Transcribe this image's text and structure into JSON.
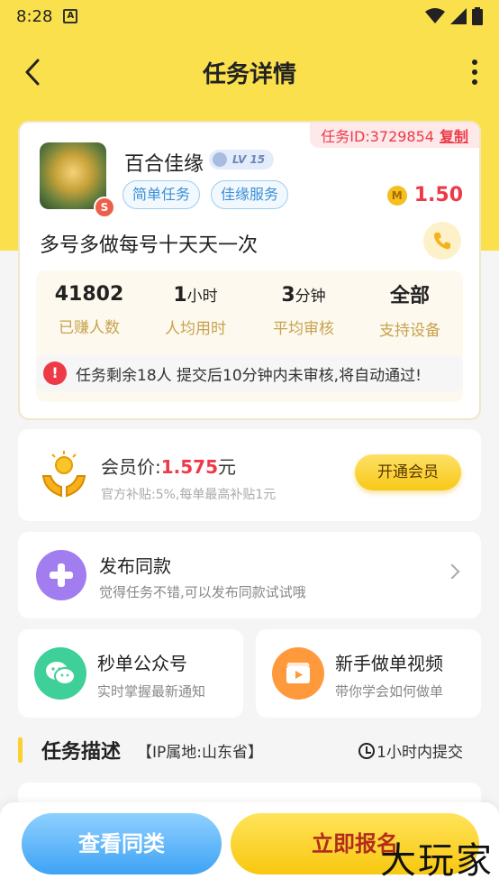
{
  "status_bar": {
    "time": "8:28",
    "notif": "A"
  },
  "nav": {
    "title": "任务详情"
  },
  "task": {
    "id_label": "任务ID:3729854",
    "copy_label": "复制",
    "shop_name": "百合佳缘",
    "level": "LV 15",
    "badge": "S",
    "tags": [
      "简单任务",
      "佳缘服务"
    ],
    "coin_letter": "M",
    "price": "1.50",
    "title": "多号多做每号十天天一次",
    "stats": [
      {
        "value": "41802",
        "unit": "",
        "label": "已赚人数"
      },
      {
        "value": "1",
        "unit": "小时",
        "label": "人均用时"
      },
      {
        "value": "3",
        "unit": "分钟",
        "label": "平均审核"
      },
      {
        "value": "全部",
        "unit": "",
        "label": "支持设备"
      }
    ],
    "notice": "任务剩余18人  提交后10分钟内未审核,将自动通过!",
    "alert_symbol": "!"
  },
  "vip": {
    "label": "会员价:",
    "price": "1.575",
    "unit": "元",
    "subsidy": "官方补贴:5%,每单最高补贴1元",
    "button": "开通会员"
  },
  "publish": {
    "title": "发布同款",
    "subtitle": "觉得任务不错,可以发布同款试试哦"
  },
  "wechat": {
    "title": "秒单公众号",
    "subtitle": "实时掌握最新通知"
  },
  "video": {
    "title": "新手做单视频",
    "subtitle": "带你学会如何做单"
  },
  "description": {
    "title": "任务描述",
    "ip": "【IP属地:山东省】",
    "deadline": "1小时内提交"
  },
  "bottom": {
    "similar": "查看同类",
    "apply": "立即报名"
  },
  "watermark": "大玩家",
  "colors": {
    "header": "#fbe04d",
    "accent_red": "#ee3a47",
    "blue": "#3ea3f5",
    "purple": "#a27df0",
    "green": "#3fcf98",
    "orange": "#ff9a3c"
  }
}
